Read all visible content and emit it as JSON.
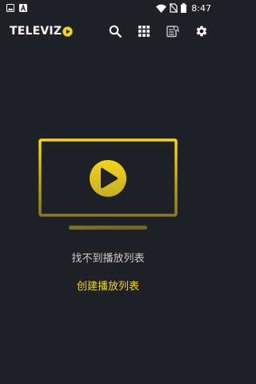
{
  "status_bar": {
    "time": "8:47",
    "icons": [
      "image-notification-icon",
      "a-notification-icon",
      "wifi-icon",
      "no-sim-icon",
      "battery-icon"
    ]
  },
  "app_bar": {
    "logo_text": "TELEVIZ",
    "actions": [
      "search-icon",
      "grid-icon",
      "epg-guide-icon",
      "settings-gear-icon"
    ]
  },
  "empty_state": {
    "message": "找不到播放列表",
    "action_label": "创建播放列表"
  },
  "colors": {
    "background": "#202126",
    "accent": "#f2d421",
    "text_secondary": "#c9c9cc",
    "text_primary": "#ffffff"
  }
}
